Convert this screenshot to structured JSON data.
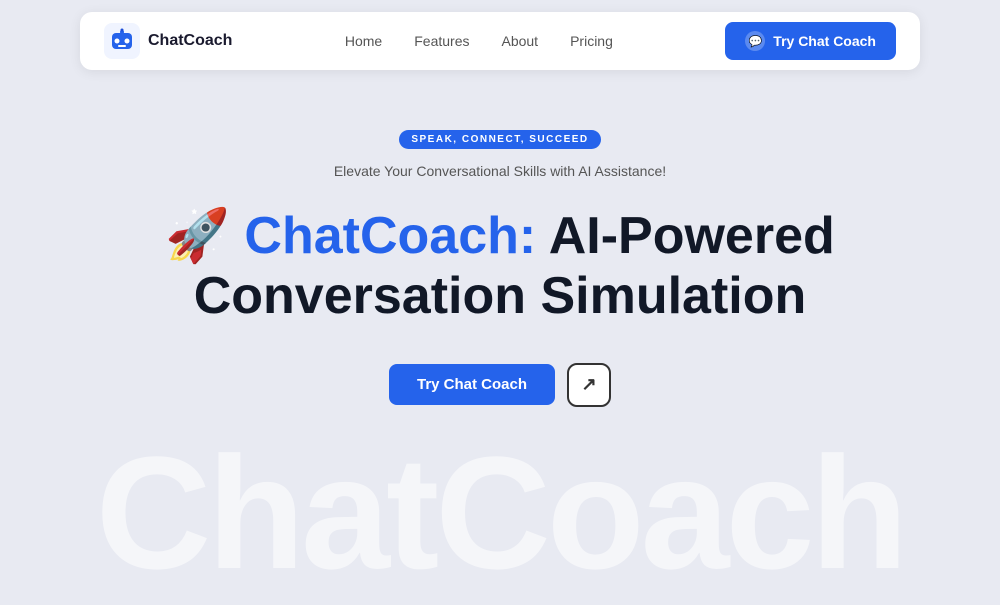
{
  "navbar": {
    "logo_text": "ChatCoach",
    "links": [
      {
        "label": "Home",
        "id": "home"
      },
      {
        "label": "Features",
        "id": "features"
      },
      {
        "label": "About",
        "id": "about"
      },
      {
        "label": "Pricing",
        "id": "pricing"
      }
    ],
    "cta_label": "Try Chat Coach"
  },
  "hero": {
    "badge": "SPEAK, CONNECT, SUCCEED",
    "subtitle": "Elevate Your Conversational Skills with AI Assistance!",
    "title_emoji": "🚀",
    "title_brand": "ChatCoach:",
    "title_rest": " AI-Powered\nConversation Simulation",
    "cta_label": "Try Chat Coach",
    "external_icon": "↗"
  },
  "watermark": {
    "text": "ChatCoach"
  }
}
